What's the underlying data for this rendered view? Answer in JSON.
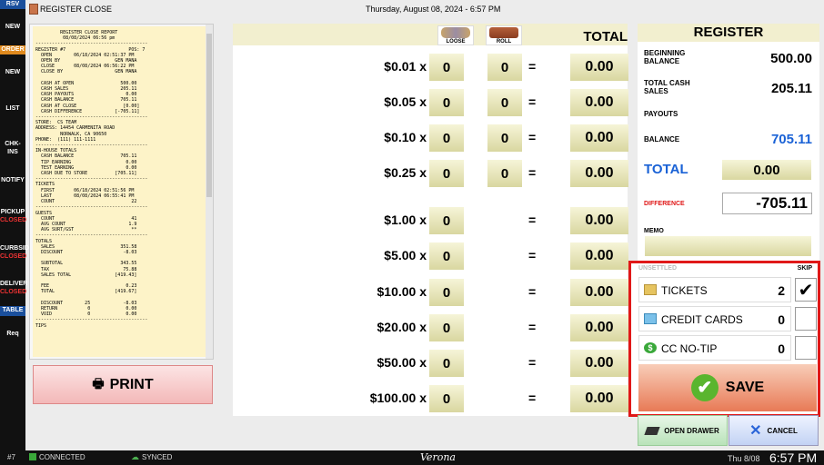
{
  "sidebar": {
    "rsv": "RSV",
    "new_top": "NEW",
    "order": "ORDER",
    "new_bottom": "NEW",
    "list": "LIST",
    "chk_ins": "CHK-INS",
    "notify": "NOTIFY",
    "pickup": "PICKUP",
    "pickup_status": "CLOSED",
    "curbside": "CURBSID",
    "curbside_status": "CLOSED",
    "delivery": "DELIVER",
    "delivery_status": "CLOSED",
    "table": "TABLE",
    "req": "Req"
  },
  "header": {
    "title": "REGISTER CLOSE",
    "datetime": "Thursday, August 08, 2024 - 6:57 PM"
  },
  "receipt_text": "         REGISTER CLOSE REPORT\n          08/08/2024 06:56 pm\n-----------------------------------------\nREGISTER #7                       POS: 7\n  OPEN        06/18/2024 02:51:37 PM\n  OPEN BY                    GEN MANA\n  CLOSE       08/08/2024 06:56:22 PM\n  CLOSE BY                   GEN MANA\n\n  CASH AT OPEN                 500.00\n  CASH SALES                   205.11\n  CASH PAYOUTS                   0.00\n  CASH BALANCE                 705.11\n  CASH AT CLOSE                 [0.00]\n  CASH DIFFERENCE            [-705.11]\n-----------------------------------------\nSTORE:  CS TEAM\nADDRESS: 14454 CARMENITA ROAD\n         NORWALK, CA 90650\nPHONE:  (111) 111-1111\n-----------------------------------------\nIN-HOUSE TOTALS\n  CASH BALANCE                 705.11\n  TIP EARNING                    0.00\n  TEST EARNING                   0.00\n  CASH DUE TO STORE          [705.11]\n-----------------------------------------\nTICKETS\n  FIRST       06/18/2024 02:51:56 PM\n  LAST        08/08/2024 06:55:41 PM\n  COUNT                            22\n-----------------------------------------\nGUESTS\n  COUNT                            41\n  AVG COUNT                       1.9\n  AVG SURT/GST                     **\n-----------------------------------------\nTOTALS\n  SALES                        351.58\n  DISCOUNT                      -8.03\n\n  SUBTOTAL                     343.55\n  TAX                           75.88\n  SALES TOTAL                [419.43]\n\n  FEE                            0.23\n  TOTAL                      [419.67]\n\n  DISCOUNT        25            -8.03\n  RETURN           0             0.00\n  VOID             0             0.00\n-----------------------------------------\nTIPS",
  "print_label": "PRINT",
  "denoms": {
    "loose_tag": "LOOSE",
    "roll_tag": "ROLL",
    "total_header": "TOTAL",
    "rows": [
      {
        "label": "$0.01 x",
        "loose": "0",
        "roll": "0",
        "eq": "=",
        "total": "0.00"
      },
      {
        "label": "$0.05 x",
        "loose": "0",
        "roll": "0",
        "eq": "=",
        "total": "0.00"
      },
      {
        "label": "$0.10 x",
        "loose": "0",
        "roll": "0",
        "eq": "=",
        "total": "0.00"
      },
      {
        "label": "$0.25 x",
        "loose": "0",
        "roll": "0",
        "eq": "=",
        "total": "0.00"
      },
      {
        "label": "$1.00 x",
        "loose": "0",
        "eq": "=",
        "total": "0.00"
      },
      {
        "label": "$5.00 x",
        "loose": "0",
        "eq": "=",
        "total": "0.00"
      },
      {
        "label": "$10.00 x",
        "loose": "0",
        "eq": "=",
        "total": "0.00"
      },
      {
        "label": "$20.00 x",
        "loose": "0",
        "eq": "=",
        "total": "0.00"
      },
      {
        "label": "$50.00 x",
        "loose": "0",
        "eq": "=",
        "total": "0.00"
      },
      {
        "label": "$100.00 x",
        "loose": "0",
        "eq": "=",
        "total": "0.00"
      }
    ]
  },
  "register": {
    "title": "REGISTER",
    "beginning_label_1": "BEGINNING",
    "beginning_label_2": "BALANCE",
    "beginning_value": "500.00",
    "total_cash_label_1": "TOTAL CASH",
    "total_cash_label_2": "SALES",
    "total_cash_value": "205.11",
    "payouts_label": "PAYOUTS",
    "balance_label": "BALANCE",
    "balance_value": "705.11",
    "total_label": "TOTAL",
    "total_value": "0.00",
    "difference_label": "DIFFERENCE",
    "difference_value": "-705.11",
    "memo_label": "MEMO"
  },
  "unsettled": {
    "label": "UNSETTLED",
    "skip_label": "SKIP",
    "tickets_label": "TICKETS",
    "tickets_count": "2",
    "tickets_skip": "✔",
    "credit_label": "CREDIT CARDS",
    "credit_count": "0",
    "cc_notip_label": "CC NO-TIP",
    "cc_notip_count": "0",
    "save_label": "SAVE"
  },
  "buttons": {
    "open_drawer": "OPEN DRAWER",
    "cancel": "CANCEL"
  },
  "status_bar": {
    "station": "#7",
    "connected": "CONNECTED",
    "synced": "SYNCED",
    "brand": "Verona",
    "date": "Thu 8/08",
    "time": "6:57 PM"
  },
  "colors": {
    "balance_blue": "#1a62d6",
    "difference_red": "#e01818",
    "highlight_red": "#e01818",
    "order_orange": "#e08a1e",
    "save_green": "#5ab52e"
  }
}
